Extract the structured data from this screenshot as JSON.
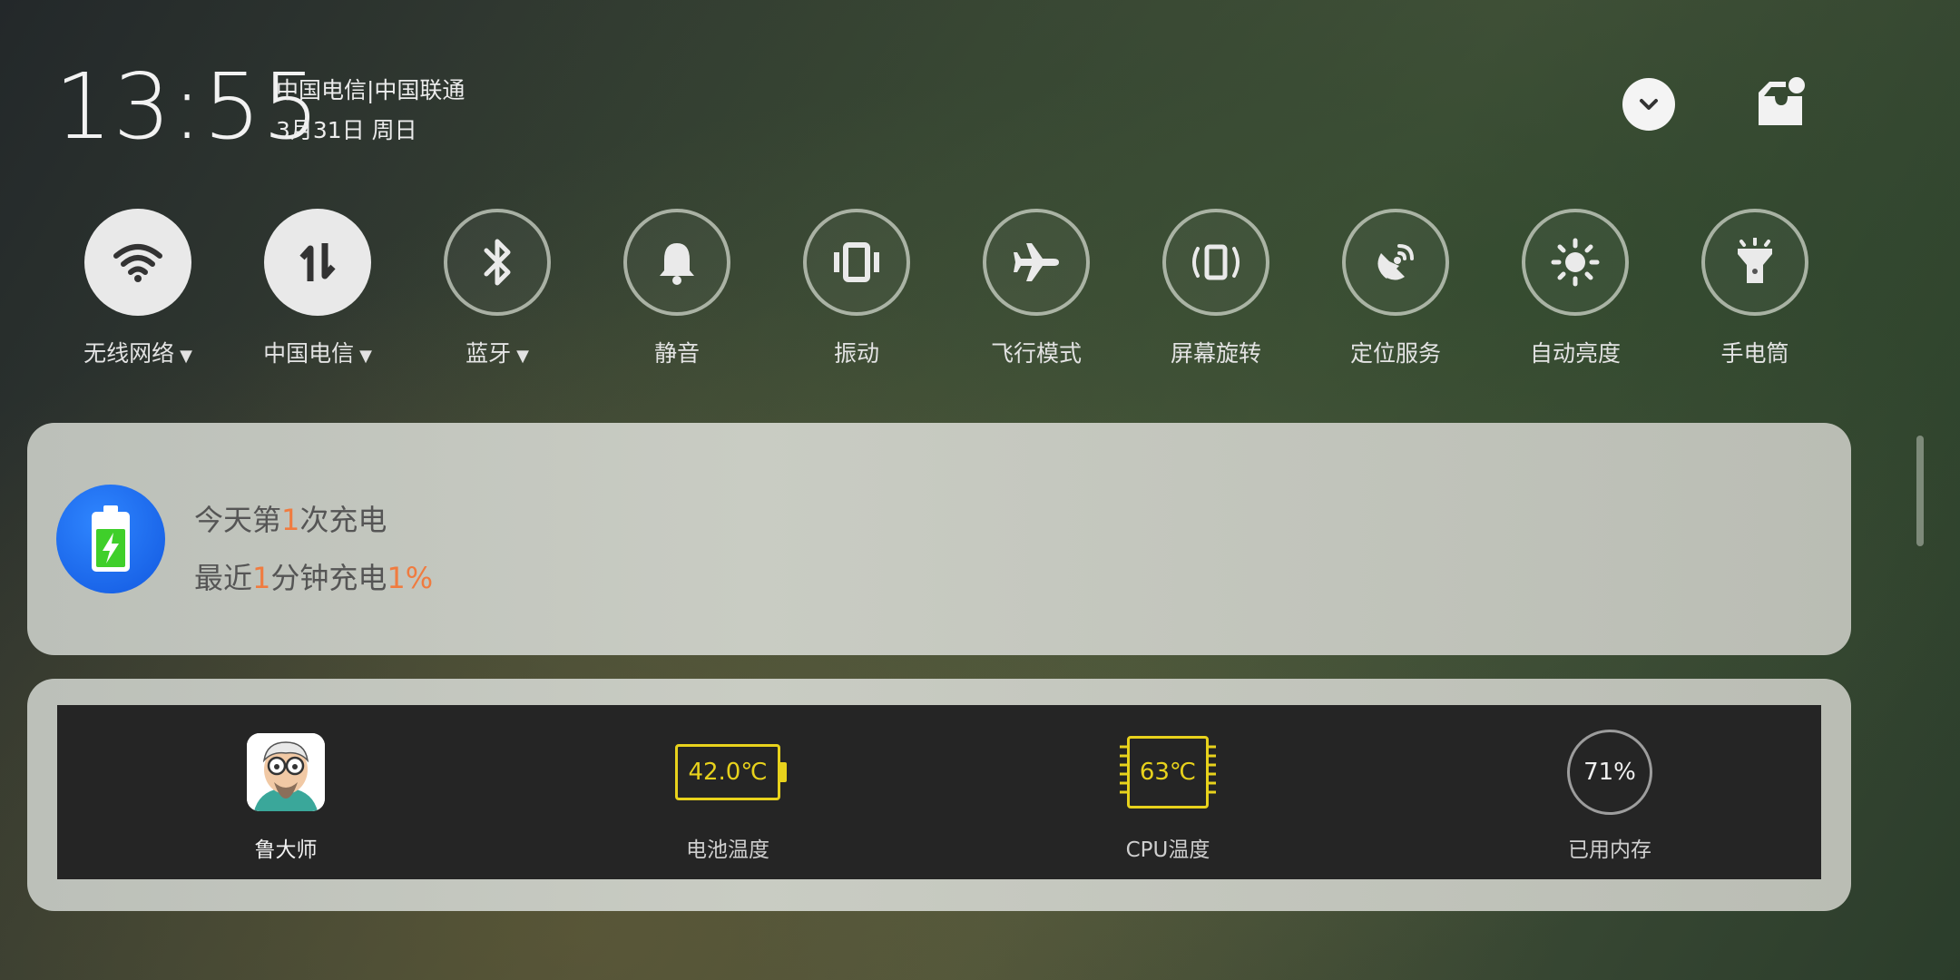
{
  "status": {
    "time": "13:55",
    "carrier": "中国电信|中国联通",
    "date": "3月31日 周日"
  },
  "header_icons": {
    "collapse": "chevron-down-icon",
    "notifications": "notification-manage-icon"
  },
  "toggles": [
    {
      "label": "无线网络",
      "icon": "wifi-icon",
      "state": "on",
      "dropdown": "▼"
    },
    {
      "label": "中国电信",
      "icon": "mobile-data-icon",
      "state": "on",
      "dropdown": "▼"
    },
    {
      "label": "蓝牙",
      "icon": "bluetooth-icon",
      "state": "off",
      "dropdown": "▼"
    },
    {
      "label": "静音",
      "icon": "bell-icon",
      "state": "off"
    },
    {
      "label": "振动",
      "icon": "vibrate-icon",
      "state": "off"
    },
    {
      "label": "飞行模式",
      "icon": "airplane-icon",
      "state": "off"
    },
    {
      "label": "屏幕旋转",
      "icon": "rotate-icon",
      "state": "off"
    },
    {
      "label": "定位服务",
      "icon": "location-icon",
      "state": "off"
    },
    {
      "label": "自动亮度",
      "icon": "brightness-icon",
      "state": "off"
    },
    {
      "label": "手电筒",
      "icon": "flashlight-icon",
      "state": "off"
    }
  ],
  "charging": {
    "icon": "battery-charging-icon",
    "line1_prefix": "今天第",
    "line1_count": "1",
    "line1_suffix": "次充电",
    "line2_prefix": "最近",
    "line2_minutes": "1",
    "line2_mid": "分钟充电",
    "line2_percent": "1%"
  },
  "stats": {
    "app_name": "鲁大师",
    "app_icon": "ludashi-avatar-icon",
    "battery_temp": "42.0℃",
    "battery_label": "电池温度",
    "cpu_temp": "63℃",
    "cpu_label": "CPU温度",
    "memory_used": "71%",
    "memory_label": "已用内存"
  },
  "colors": {
    "highlight": "#f07b3f",
    "temp_yellow": "#e8d21c",
    "charge_blue": "#1c6cf0",
    "battery_green": "#3fcf2a"
  }
}
